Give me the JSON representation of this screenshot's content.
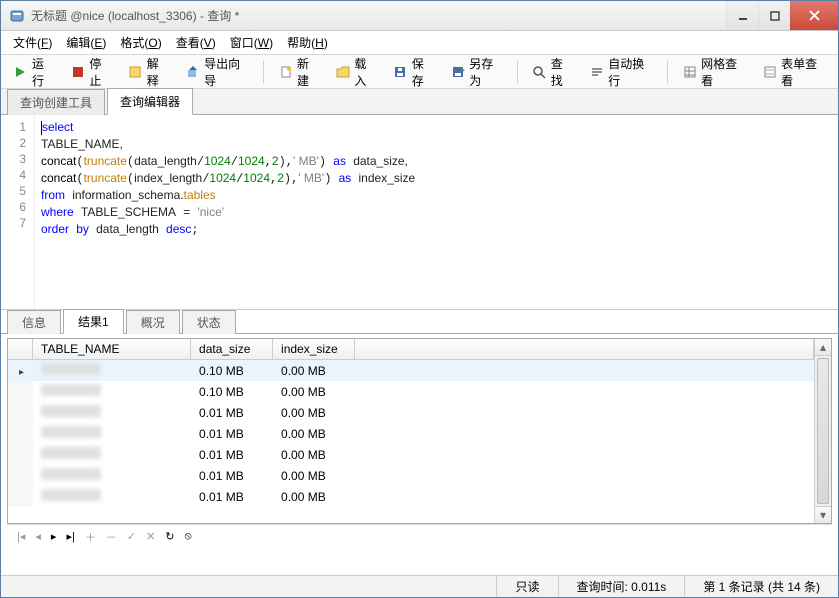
{
  "title": "无标题 @nice (localhost_3306) - 查询 *",
  "menus": [
    {
      "label": "文件",
      "mn": "F"
    },
    {
      "label": "编辑",
      "mn": "E"
    },
    {
      "label": "格式",
      "mn": "O"
    },
    {
      "label": "查看",
      "mn": "V"
    },
    {
      "label": "窗口",
      "mn": "W"
    },
    {
      "label": "帮助",
      "mn": "H"
    }
  ],
  "toolbar": {
    "run": "运行",
    "stop": "停止",
    "explain": "解释",
    "export_wizard": "导出向导",
    "new": "新建",
    "load": "载入",
    "save": "保存",
    "save_as": "另存为",
    "find": "查找",
    "autowrap": "自动换行",
    "grid_view": "网格查看",
    "form_view": "表单查看"
  },
  "editor_tabs": {
    "builder": "查询创建工具",
    "editor": "查询编辑器"
  },
  "code_lines": [
    {
      "n": 1
    },
    {
      "n": 2
    },
    {
      "n": 3
    },
    {
      "n": 4
    },
    {
      "n": 5
    },
    {
      "n": 6
    },
    {
      "n": 7
    }
  ],
  "code": {
    "l1_select": "select",
    "l2": "TABLE_NAME,",
    "l3_concat": "concat",
    "l3_truncate": "truncate",
    "l3_data_length": "data_length",
    "l3_1024a": "1024",
    "l3_1024b": "1024",
    "l3_2": "2",
    "l3_mb": "' MB'",
    "l3_as": "as",
    "l3_alias": "data_size,",
    "l4_index_length": "index_length",
    "l4_alias": "index_size",
    "l5_from": "from",
    "l5_schema": "information_schema",
    "l5_tables": "tables",
    "l6_where": "where",
    "l6_col": "TABLE_SCHEMA",
    "l6_eq": "=",
    "l6_val": "'nice'",
    "l7_order": "order",
    "l7_by": "by",
    "l7_col": "data_length",
    "l7_desc": "desc"
  },
  "result_tabs": {
    "info": "信息",
    "result1": "结果1",
    "profile": "概况",
    "status": "状态"
  },
  "grid": {
    "columns": [
      "TABLE_NAME",
      "data_size",
      "index_size"
    ],
    "rows": [
      {
        "data_size": "0.10 MB",
        "index_size": "0.00 MB"
      },
      {
        "data_size": "0.10 MB",
        "index_size": "0.00 MB"
      },
      {
        "data_size": "0.01 MB",
        "index_size": "0.00 MB"
      },
      {
        "data_size": "0.01 MB",
        "index_size": "0.00 MB"
      },
      {
        "data_size": "0.01 MB",
        "index_size": "0.00 MB"
      },
      {
        "data_size": "0.01 MB",
        "index_size": "0.00 MB"
      },
      {
        "data_size": "0.01 MB",
        "index_size": "0.00 MB"
      }
    ]
  },
  "status": {
    "readonly": "只读",
    "query_time": "查询时间: 0.011s",
    "record": "第 1 条记录 (共 14 条)"
  }
}
